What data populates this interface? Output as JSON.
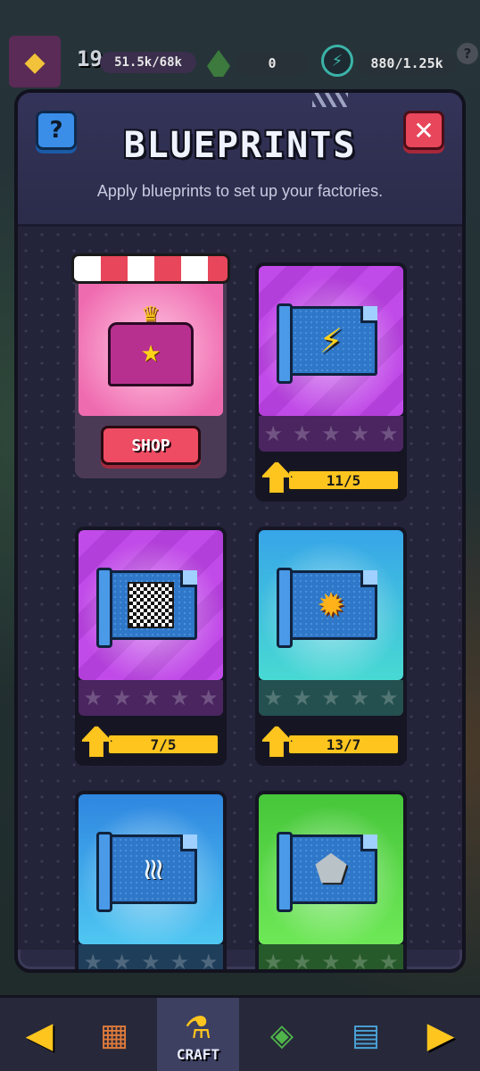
{
  "hud": {
    "level": "19",
    "xp": "51.5k/68k",
    "gems": "0",
    "energy": "880/1.25k",
    "help": "?"
  },
  "modal": {
    "title": "BLUEPRINTS",
    "subtitle": "Apply blueprints to set up your factories.",
    "help_label": "?",
    "close_label": "✕"
  },
  "shop": {
    "button_label": "SHOP"
  },
  "cards": [
    {
      "icon": "lightning-icon",
      "count": "11/5",
      "stars": 0,
      "max_stars": 5,
      "color": "#c14be8"
    },
    {
      "icon": "checkered-icon",
      "count": "7/5",
      "stars": 0,
      "max_stars": 5,
      "color": "#c14be8"
    },
    {
      "icon": "fire-icon",
      "count": "13/7",
      "stars": 0,
      "max_stars": 5,
      "color": "#48d9d3"
    },
    {
      "icon": "heat-waves-icon",
      "count": "",
      "stars": 0,
      "max_stars": 5,
      "color": "#4fc7f2"
    },
    {
      "icon": "rock-icon",
      "count": "",
      "stars": 0,
      "max_stars": 5,
      "color": "#6ee857"
    }
  ],
  "nav": {
    "active_label": "CRAFT"
  }
}
